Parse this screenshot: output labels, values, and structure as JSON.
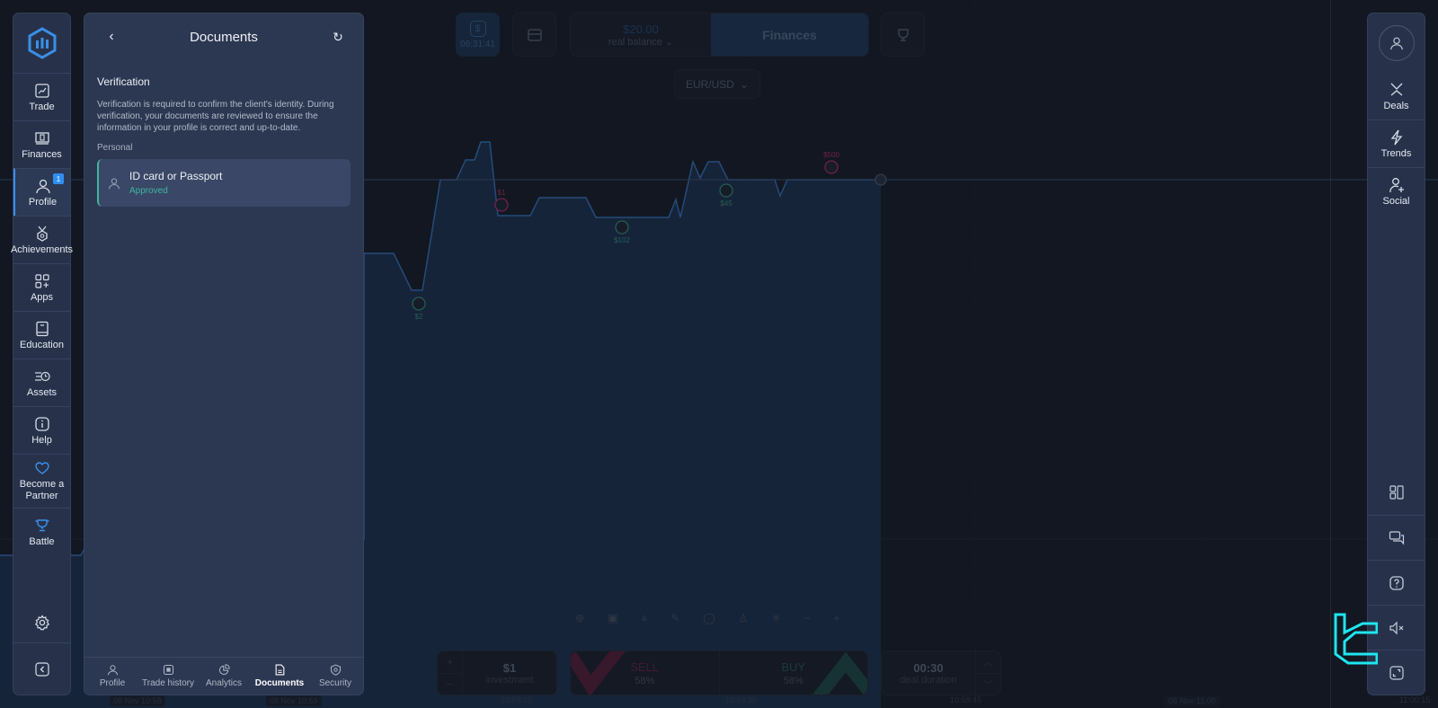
{
  "top": {
    "timer": "06:31:41",
    "balance_amount": "$20.00",
    "balance_label": "real balance",
    "finances_label": "Finances",
    "pair": "EUR/USD"
  },
  "left_nav": {
    "items": [
      {
        "label": "Trade",
        "icon": "chart-icon"
      },
      {
        "label": "Finances",
        "icon": "finances-icon"
      },
      {
        "label": "Profile",
        "icon": "user-icon",
        "badge": "1",
        "active": true
      },
      {
        "label": "Achievements",
        "icon": "medal-icon"
      },
      {
        "label": "Apps",
        "icon": "apps-icon"
      },
      {
        "label": "Education",
        "icon": "book-icon"
      },
      {
        "label": "Assets",
        "icon": "assets-icon"
      },
      {
        "label": "Help",
        "icon": "info-icon"
      },
      {
        "label": "Become a Partner",
        "icon": "heart-icon"
      },
      {
        "label": "Battle",
        "icon": "trophy-icon"
      }
    ]
  },
  "panel": {
    "title": "Documents",
    "section_title": "Verification",
    "section_desc": "Verification is required to confirm the client's identity. During verification, your documents are reviewed to ensure the information in your profile is correct and up-to-date.",
    "group_label": "Personal",
    "document": {
      "title": "ID card or Passport",
      "status": "Approved"
    },
    "tabs": [
      {
        "label": "Profile",
        "icon": "user-icon"
      },
      {
        "label": "Trade history",
        "icon": "history-icon"
      },
      {
        "label": "Analytics",
        "icon": "analytics-icon"
      },
      {
        "label": "Documents",
        "icon": "document-icon",
        "active": true
      },
      {
        "label": "Security",
        "icon": "shield-icon"
      }
    ]
  },
  "right_nav": {
    "items": [
      {
        "label": "Deals",
        "icon": "deals-icon"
      },
      {
        "label": "Trends",
        "icon": "lightning-icon"
      },
      {
        "label": "Social",
        "icon": "add-user-icon"
      }
    ],
    "bottom_icons": [
      "layout-icon",
      "chat-icon",
      "help-icon",
      "mute-icon",
      "fullscreen-icon"
    ]
  },
  "trade": {
    "investment_value": "$1",
    "investment_label": "investment",
    "sell_label": "SELL",
    "sell_pct": "58%",
    "buy_label": "BUY",
    "buy_pct": "58%",
    "duration_value": "00:30",
    "duration_label": "deal duration"
  },
  "chart": {
    "trade_markers": [
      {
        "label": "$2",
        "type": "buy"
      },
      {
        "label": "$1",
        "type": "sell"
      },
      {
        "label": "$102",
        "type": "buy"
      },
      {
        "label": "$45",
        "type": "buy"
      },
      {
        "label": "$500",
        "type": "sell"
      }
    ],
    "time_labels": [
      "08 Nov 10:58",
      "08 Nov 10:59",
      "10:59:15",
      "10:59:30",
      "10:59:45",
      "08 Nov 11:00",
      "11:00:15"
    ]
  },
  "colors": {
    "accent": "#3c8ef0",
    "approved": "#3fb6a0",
    "sell": "#c0306a",
    "buy": "#3a9b7e"
  }
}
